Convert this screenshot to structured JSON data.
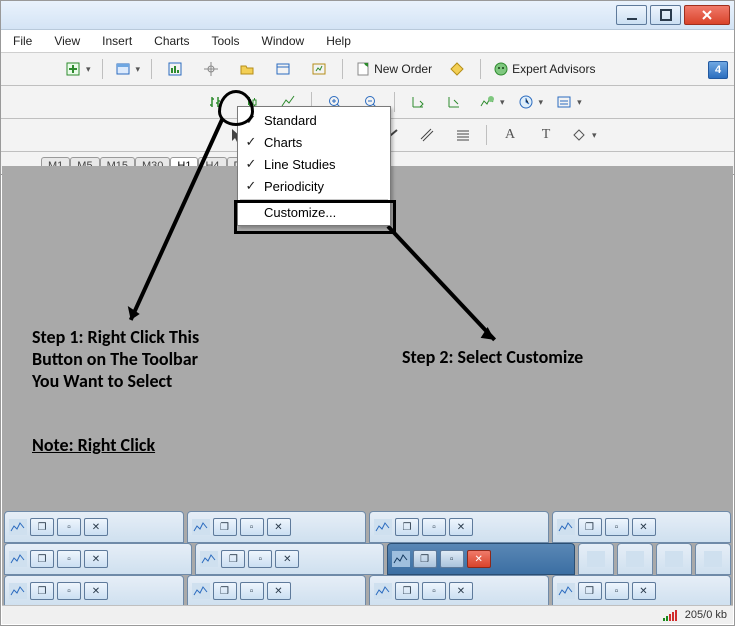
{
  "window_controls": {
    "minimize": "minimize-icon",
    "maximize": "maximize-icon",
    "close": "close-icon"
  },
  "menu": [
    "File",
    "View",
    "Insert",
    "Charts",
    "Tools",
    "Window",
    "Help"
  ],
  "toolbar1": {
    "new_order": "New Order",
    "expert_advisors": "Expert Advisors",
    "badge": "4"
  },
  "periods": [
    "M1",
    "M5",
    "M15",
    "M30",
    "H1",
    "H4",
    "D"
  ],
  "selected_period": "H1",
  "context_menu": {
    "items": [
      {
        "label": "Standard",
        "checked": true
      },
      {
        "label": "Charts",
        "checked": true
      },
      {
        "label": "Line Studies",
        "checked": true
      },
      {
        "label": "Periodicity",
        "checked": true
      }
    ],
    "customize_label": "Customize..."
  },
  "annotations": {
    "step1": "Step 1: Right Click This\nButton on The Toolbar\nYou Want to Select",
    "step2": "Step 2: Select Customize",
    "note": "Note: Right Click"
  },
  "status": {
    "rate": "205/0 kb"
  }
}
